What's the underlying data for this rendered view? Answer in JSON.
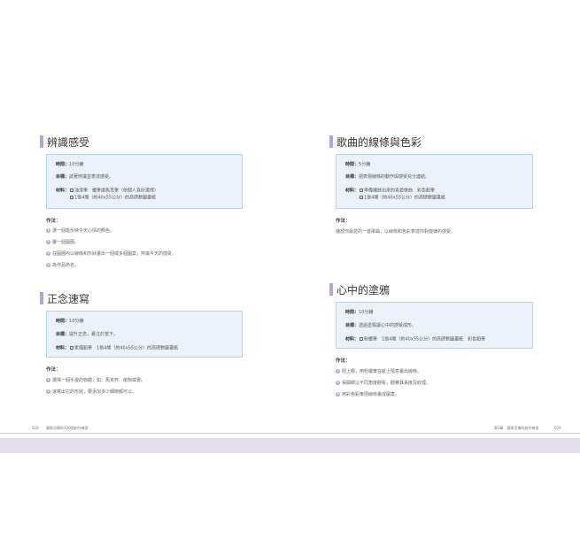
{
  "sections": {
    "s1": {
      "title": "辨識感受",
      "time_label": "時間：",
      "time_value": "10分鐘",
      "goal_label": "目標：",
      "goal_value": "試著辨識並表達感受。",
      "mat_label": "材料：",
      "mat_line1": "油漆筆　蠟筆或馬克筆（依個人喜好選擇）",
      "mat_line2": "1張4開（約40x55公分）的高磅數圖畫紙",
      "howto": "作法：",
      "steps": [
        "選一個能反映今天心情的顏色。",
        "畫一個圓圈。",
        "在圓圈內以線條和形狀畫出一個或多個圖案，辨識今天的感受。",
        "為作品命名。"
      ]
    },
    "s2": {
      "title": "正念速寫",
      "time_label": "時間：",
      "time_value": "10分鐘",
      "goal_label": "目標：",
      "goal_value": "提升正念，專注於當下。",
      "mat_label": "材料：",
      "mat_line1": "素描鉛筆　1張4開（約40x55公分）的高磅數圖畫紙",
      "howto": "作法：",
      "steps": [
        "選擇一個手邊的物體，如：馬克杯、植物或書。",
        "速寫出它的形狀；要添加多少細節都可以。"
      ]
    },
    "s3": {
      "title": "歌曲的線條與色彩",
      "time_label": "時間：",
      "time_value": "5分鐘",
      "goal_label": "目標：",
      "goal_value": "把表現線條的動作與感受充分連結。",
      "mat_label": "材料：",
      "mat_line1": "準備播放出來的喜愛歌曲　彩色鉛筆",
      "mat_line2": "1張4開（約40x55公分）的高磅數圖畫紙",
      "howto": "作法：",
      "text": "播放你最愛的一首歌曲，以線條和色彩表達你對旋律的感受。"
    },
    "s4": {
      "title": "心中的塗鴉",
      "time_label": "時間：",
      "time_value": "10分鐘",
      "goal_label": "目標：",
      "goal_value": "透過塗鴉讓心中的感受成形。",
      "mat_label": "材料：",
      "mat_line1": "粉蠟筆　1張4開（約40x55公分）的高磅數圖畫紙　彩色鉛筆",
      "howto": "作法：",
      "steps": [
        "閉上眼，用粉蠟筆在紙上隨意畫出線條。",
        "張開眼以不同角度觀看，觀察其長度及紋理。",
        "用彩色鉛筆把線條畫成圖案。"
      ]
    }
  },
  "footer": {
    "left_page": "028",
    "left_title": "藝術治療的100個創作練習",
    "right_chapter": "第1章　藝術治療的創作練習",
    "right_page": "029"
  }
}
